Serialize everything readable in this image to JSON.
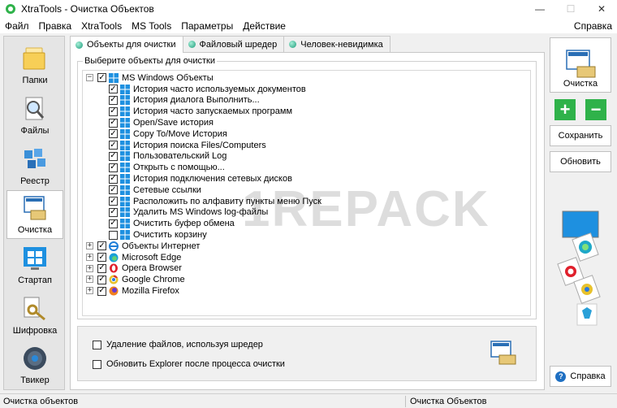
{
  "window": {
    "title": "XtraTools - Очистка Объектов",
    "controls": {
      "minimize": "—",
      "maximize": "☐",
      "close": "✕"
    }
  },
  "menu": {
    "items": [
      "Файл",
      "Правка",
      "XtraTools",
      "MS Tools",
      "Параметры",
      "Действие"
    ],
    "right": "Справка"
  },
  "sidebar": {
    "items": [
      {
        "label": "Папки",
        "icon": "folder-icon",
        "active": false
      },
      {
        "label": "Файлы",
        "icon": "file-search-icon",
        "active": false
      },
      {
        "label": "Реестр",
        "icon": "registry-icon",
        "active": false
      },
      {
        "label": "Очистка",
        "icon": "cleanup-icon",
        "active": true
      },
      {
        "label": "Стартап",
        "icon": "startup-windows-icon",
        "active": false
      },
      {
        "label": "Шифровка",
        "icon": "key-encrypt-icon",
        "active": false
      },
      {
        "label": "Твикер",
        "icon": "gear-tweaker-icon",
        "active": false
      }
    ]
  },
  "tabs": [
    {
      "label": "Объекты для очистки",
      "active": true
    },
    {
      "label": "Файловый шредер",
      "active": false
    },
    {
      "label": "Человек-невидимка",
      "active": false
    }
  ],
  "objects_group": {
    "title": "Выберите объекты для очистки",
    "root": {
      "label": "MS Windows Объекты",
      "expander": "−",
      "checked": true,
      "icon": "windows-icon"
    },
    "children": [
      {
        "label": "История часто используемых документов",
        "checked": true
      },
      {
        "label": "История диалога Выполнить...",
        "checked": true
      },
      {
        "label": "История часто запускаемых программ",
        "checked": true
      },
      {
        "label": "Open/Save история",
        "checked": true
      },
      {
        "label": "Copy To/Move История",
        "checked": true
      },
      {
        "label": "История поиска Files/Computers",
        "checked": true
      },
      {
        "label": "Пользовательский Log",
        "checked": true
      },
      {
        "label": "Открыть с помощью...",
        "checked": true
      },
      {
        "label": "История подключения сетевых дисков",
        "checked": true
      },
      {
        "label": "Сетевые ссылки",
        "checked": true
      },
      {
        "label": "Расположить по алфавиту пункты меню Пуск",
        "checked": true
      },
      {
        "label": "Удалить MS Windows log-файлы",
        "checked": true
      },
      {
        "label": "Очистить буфер обмена",
        "checked": true
      },
      {
        "label": "Очистить корзину",
        "checked": false
      }
    ],
    "others": [
      {
        "label": "Объекты Интернет",
        "expander": "+",
        "checked": true,
        "icon": "ie-icon"
      },
      {
        "label": "Microsoft Edge",
        "expander": "+",
        "checked": true,
        "icon": "edge-icon"
      },
      {
        "label": "Opera Browser",
        "expander": "+",
        "checked": true,
        "icon": "opera-icon"
      },
      {
        "label": "Google Chrome",
        "expander": "+",
        "checked": true,
        "icon": "chrome-icon"
      },
      {
        "label": "Mozilla Firefox",
        "expander": "+",
        "checked": true,
        "icon": "firefox-icon"
      }
    ]
  },
  "options": {
    "shredder": {
      "label": "Удаление файлов, используя шредер",
      "checked": false
    },
    "refresh_explorer": {
      "label": "Обновить Explorer после процесса очистки",
      "checked": false
    }
  },
  "actions": {
    "clean": "Очистка",
    "add": "+",
    "remove": "−",
    "save": "Сохранить",
    "refresh": "Обновить",
    "help": "Справка"
  },
  "status": {
    "left": "Очистка объектов",
    "right": "Очистка Объектов"
  },
  "watermark": "1REPACK",
  "colors": {
    "accent_green": "#2fb24a",
    "windows_blue": "#1e90e0",
    "checkbox_mark": "#000000"
  }
}
